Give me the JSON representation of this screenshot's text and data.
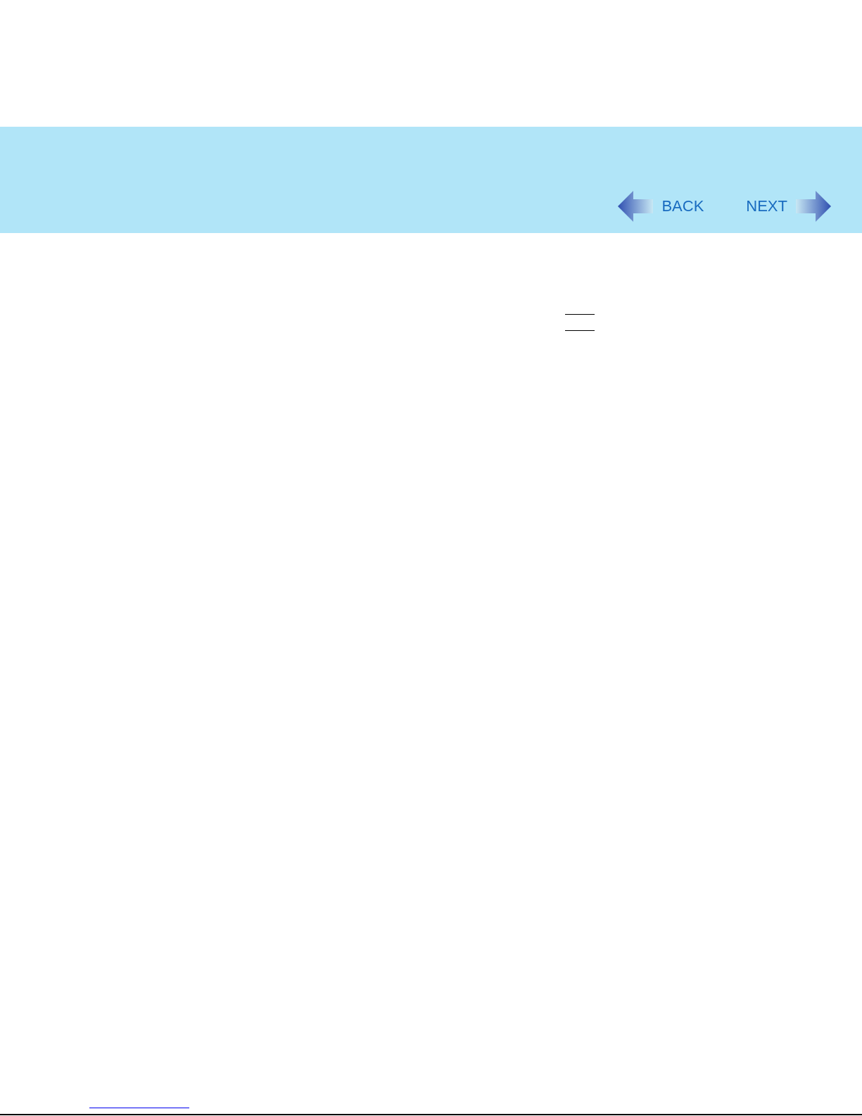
{
  "header": {
    "nav": [
      {
        "kind": "back",
        "label": "BACK"
      },
      {
        "kind": "next",
        "label": "NEXT"
      }
    ]
  }
}
